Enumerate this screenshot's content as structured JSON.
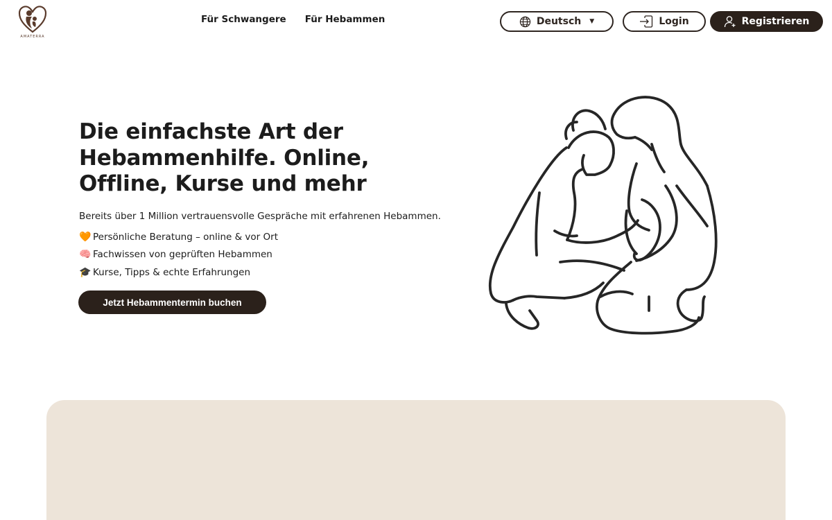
{
  "brand": {
    "logo_text": "AMATERRA"
  },
  "nav": {
    "items": [
      {
        "label": "Für Schwangere"
      },
      {
        "label": "Für Hebammen"
      }
    ]
  },
  "header": {
    "language_label": "Deutsch",
    "login_label": "Login",
    "register_label": "Registrieren"
  },
  "hero": {
    "title": "Die einfachste Art der Hebammenhilfe. Online, Offline, Kurse und mehr",
    "subtitle": "Bereits über 1 Million vertrauensvolle Gespräche mit erfahrenen Hebammen.",
    "features": [
      {
        "emoji": "🧡",
        "text": "Persönliche Beratung – online & vor Ort"
      },
      {
        "emoji": "🧠",
        "text": "Fachwissen von geprüften Hebammen"
      },
      {
        "emoji": "🎓",
        "text": "Kurse, Tipps & echte Erfahrungen"
      }
    ],
    "cta_label": "Jetzt Hebammentermin buchen"
  },
  "icons": {
    "logo": "mother-child-heart-icon",
    "language": "globe-icon",
    "login": "login-arrow-icon",
    "register": "user-plus-icon",
    "dropdown": "caret-down-icon"
  },
  "colors": {
    "primary_dark": "#2b211b",
    "card_bg": "#ede4d9",
    "logo_brown": "#5a3b2c",
    "text": "#1c1c1c"
  }
}
